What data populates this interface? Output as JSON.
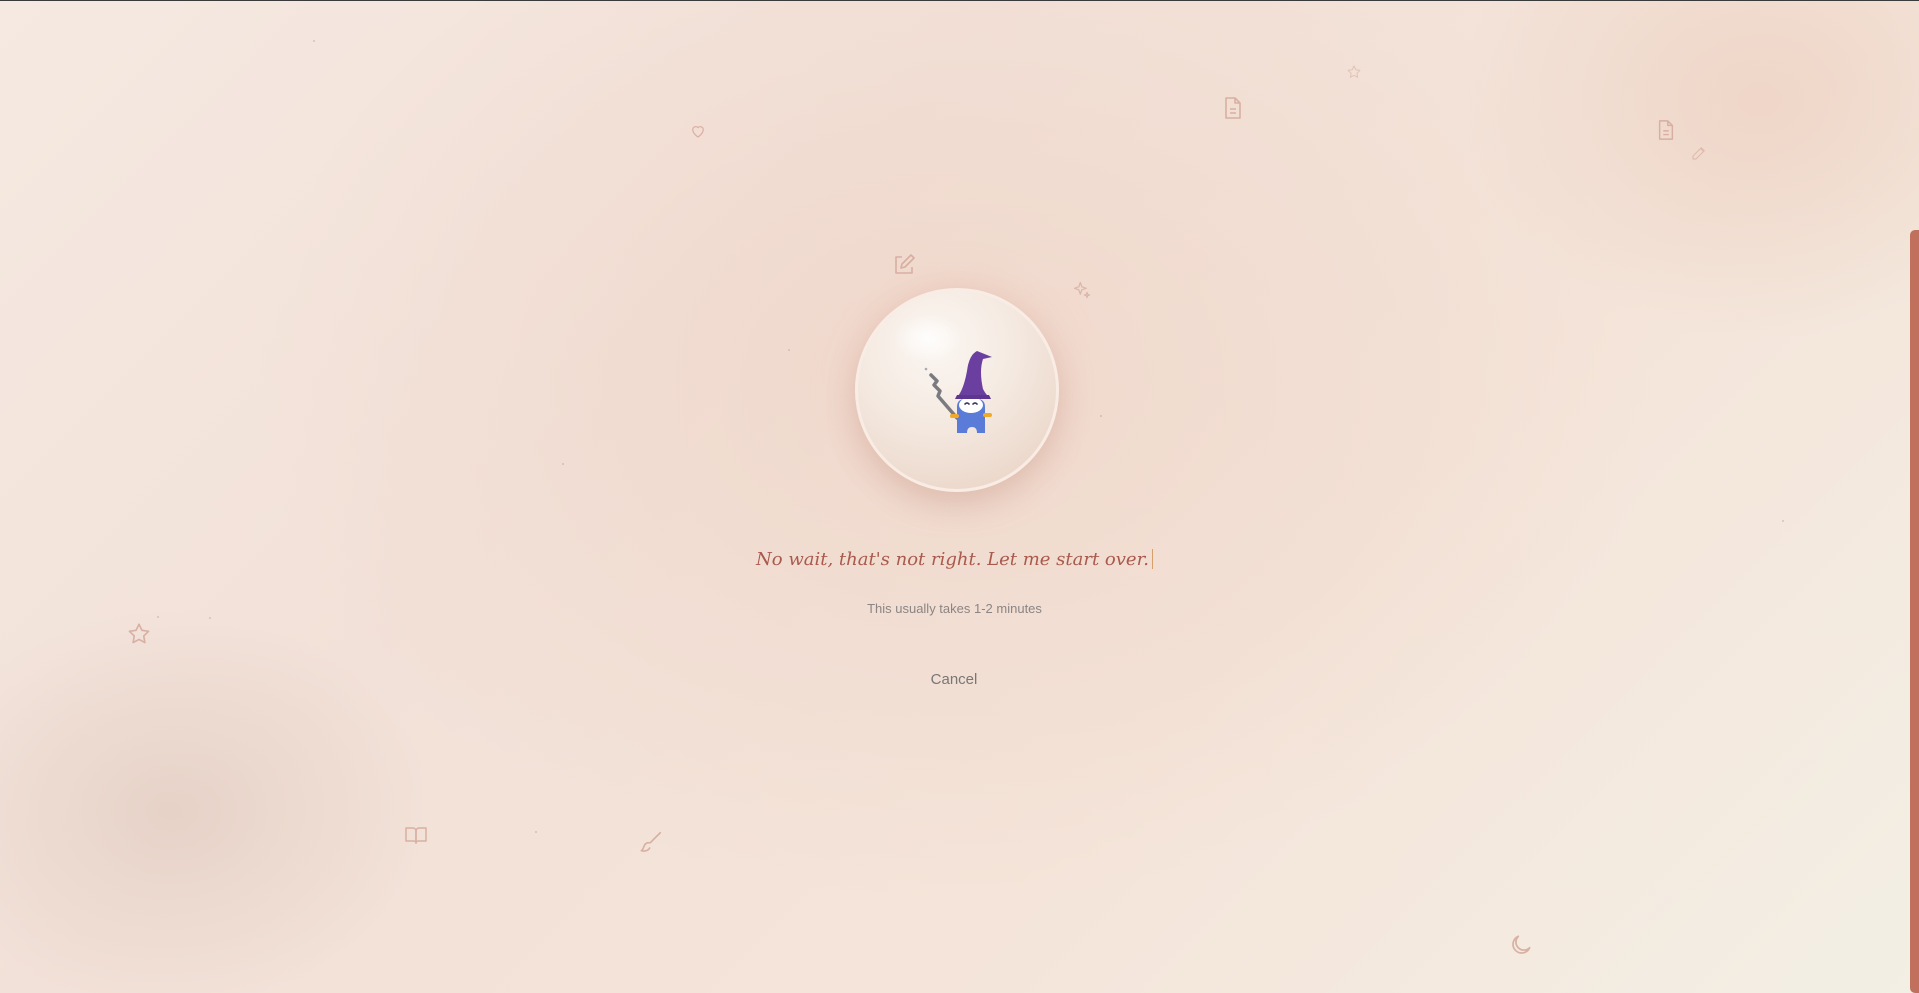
{
  "loading": {
    "message": "No wait, that's not right. Let me start over.",
    "subtext": "This usually takes 1-2 minutes",
    "cancel_label": "Cancel"
  },
  "mascot": {
    "icon": "wizard-icon",
    "hat_color": "#6b3fa0",
    "body_color": "#5b7bd8",
    "orb_icon": "crystal-ball-icon"
  },
  "decorations": [
    "heart-icon",
    "document-icon",
    "star-icon",
    "pencil-icon",
    "sparkle-icon",
    "book-icon",
    "brush-icon",
    "moon-icon"
  ],
  "colors": {
    "accent": "#c2705e",
    "message": "#a95a4c",
    "subtext": "#8a8584"
  }
}
